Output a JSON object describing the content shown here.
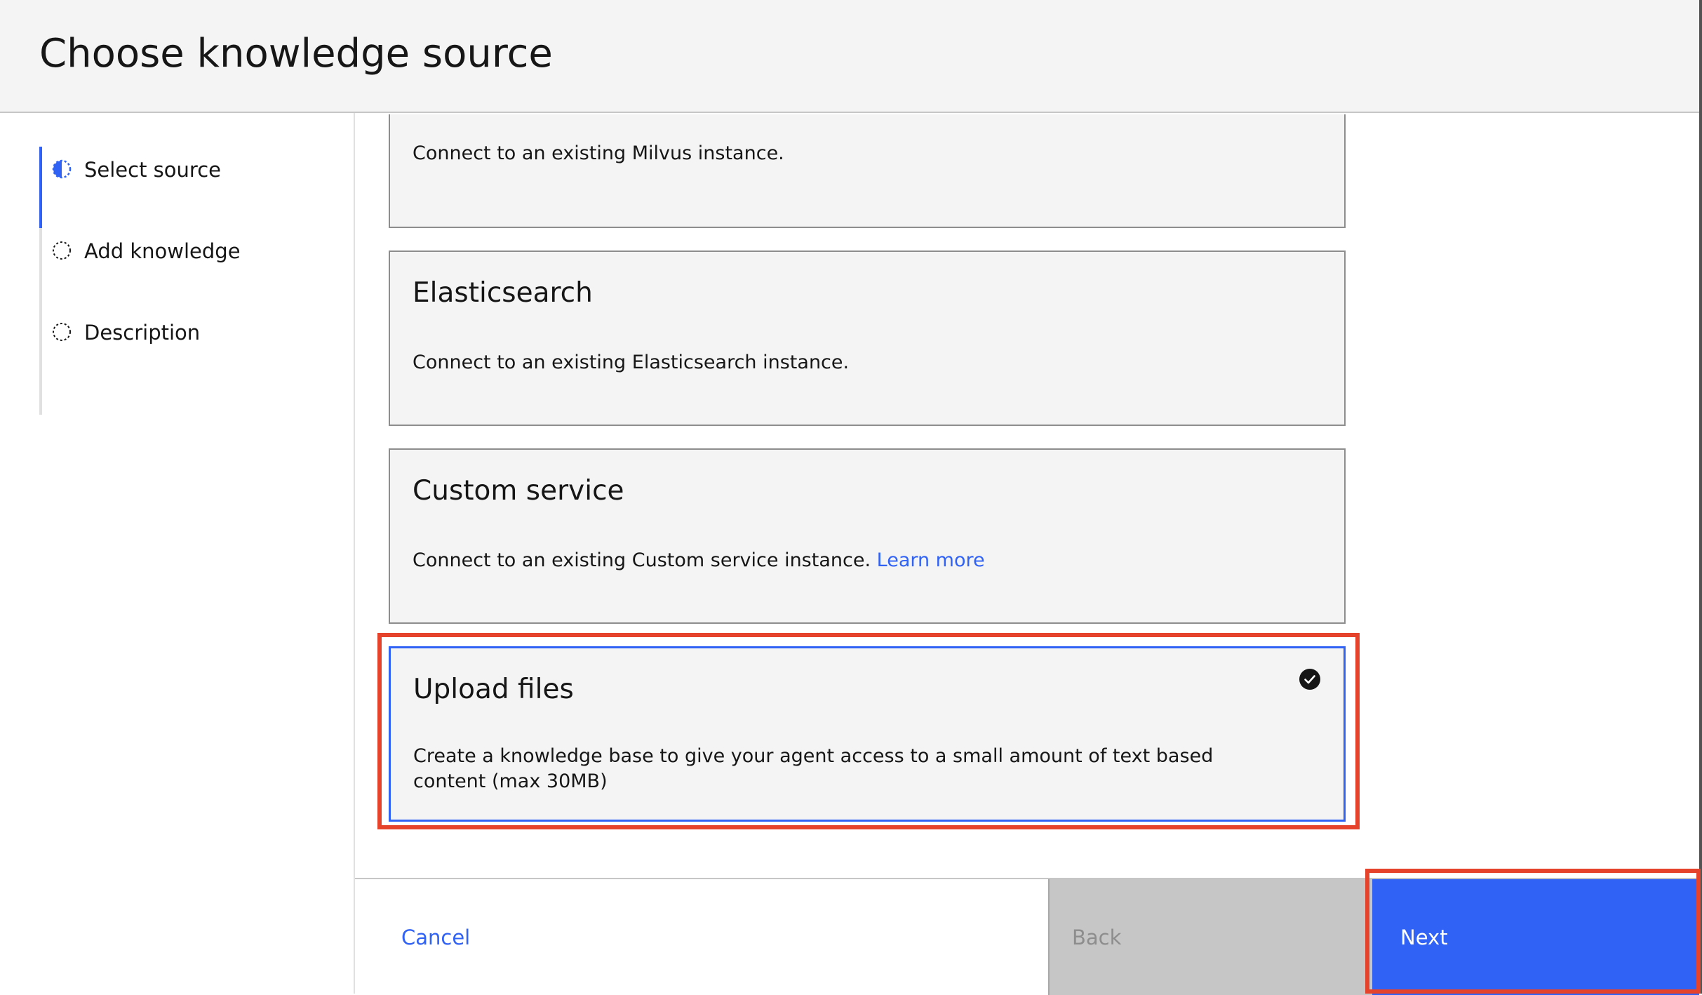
{
  "header": {
    "title": "Choose knowledge source"
  },
  "steps": [
    {
      "label": "Select source",
      "state": "current",
      "icon": "half-circle-icon"
    },
    {
      "label": "Add knowledge",
      "state": "incomplete",
      "icon": "dashed-circle-icon"
    },
    {
      "label": "Description",
      "state": "incomplete",
      "icon": "dashed-circle-icon"
    }
  ],
  "sources": [
    {
      "title": "",
      "description": "Connect to an existing Milvus instance."
    },
    {
      "title": "Elasticsearch",
      "description": "Connect to an existing Elasticsearch instance."
    },
    {
      "title": "Custom service",
      "description": "Connect to an existing Custom service instance.",
      "link": "Learn more"
    },
    {
      "title": "Upload files",
      "description": "Create a knowledge base to give your agent access to a small amount of text based content (max 30MB)",
      "selected": true
    }
  ],
  "footer": {
    "cancel_label": "Cancel",
    "back_label": "Back",
    "next_label": "Next"
  },
  "colors": {
    "accent": "#3062f6",
    "highlight": "#e5432c",
    "tile_bg": "#f4f4f4"
  }
}
